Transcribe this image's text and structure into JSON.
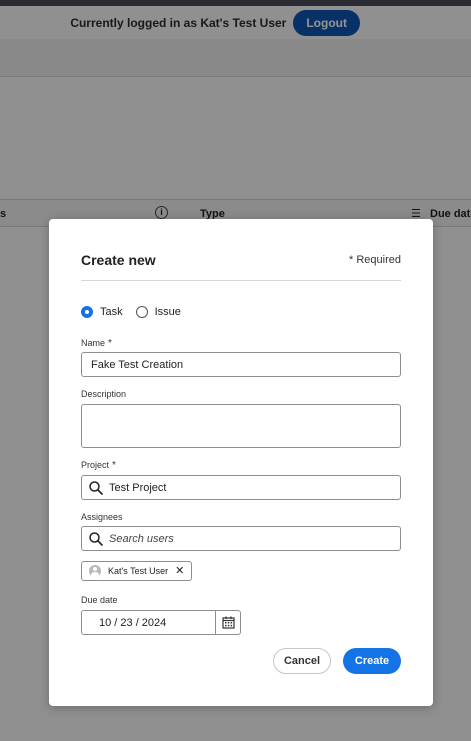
{
  "header": {
    "logged_in_text": "Currently logged in as Kat's Test User",
    "logout_label": "Logout"
  },
  "table": {
    "col_fragment": "s",
    "col_type": "Type",
    "col_due": "Due date"
  },
  "modal": {
    "title": "Create new",
    "required_note": "* Required",
    "type_options": [
      {
        "label": "Task",
        "checked": true
      },
      {
        "label": "Issue",
        "checked": false
      }
    ],
    "name_label": "Name",
    "name_value": "Fake Test Creation",
    "description_label": "Description",
    "description_value": "",
    "project_label": "Project",
    "project_value": "Test Project",
    "assignees_label": "Assignees",
    "assignees_placeholder": "Search users",
    "assignee_tag": "Kat's Test User",
    "due_label": "Due date",
    "due_value": "10 / 23 / 2024",
    "required_star": "*",
    "cancel_label": "Cancel",
    "create_label": "Create"
  },
  "colors": {
    "primary": "#1473e6",
    "logout_bg": "#0f55b2"
  },
  "icons": {
    "search": "search-icon",
    "calendar": "calendar-icon",
    "close": "close-icon",
    "avatar": "avatar-icon",
    "info": "info-icon",
    "sort": "sort-icon"
  }
}
